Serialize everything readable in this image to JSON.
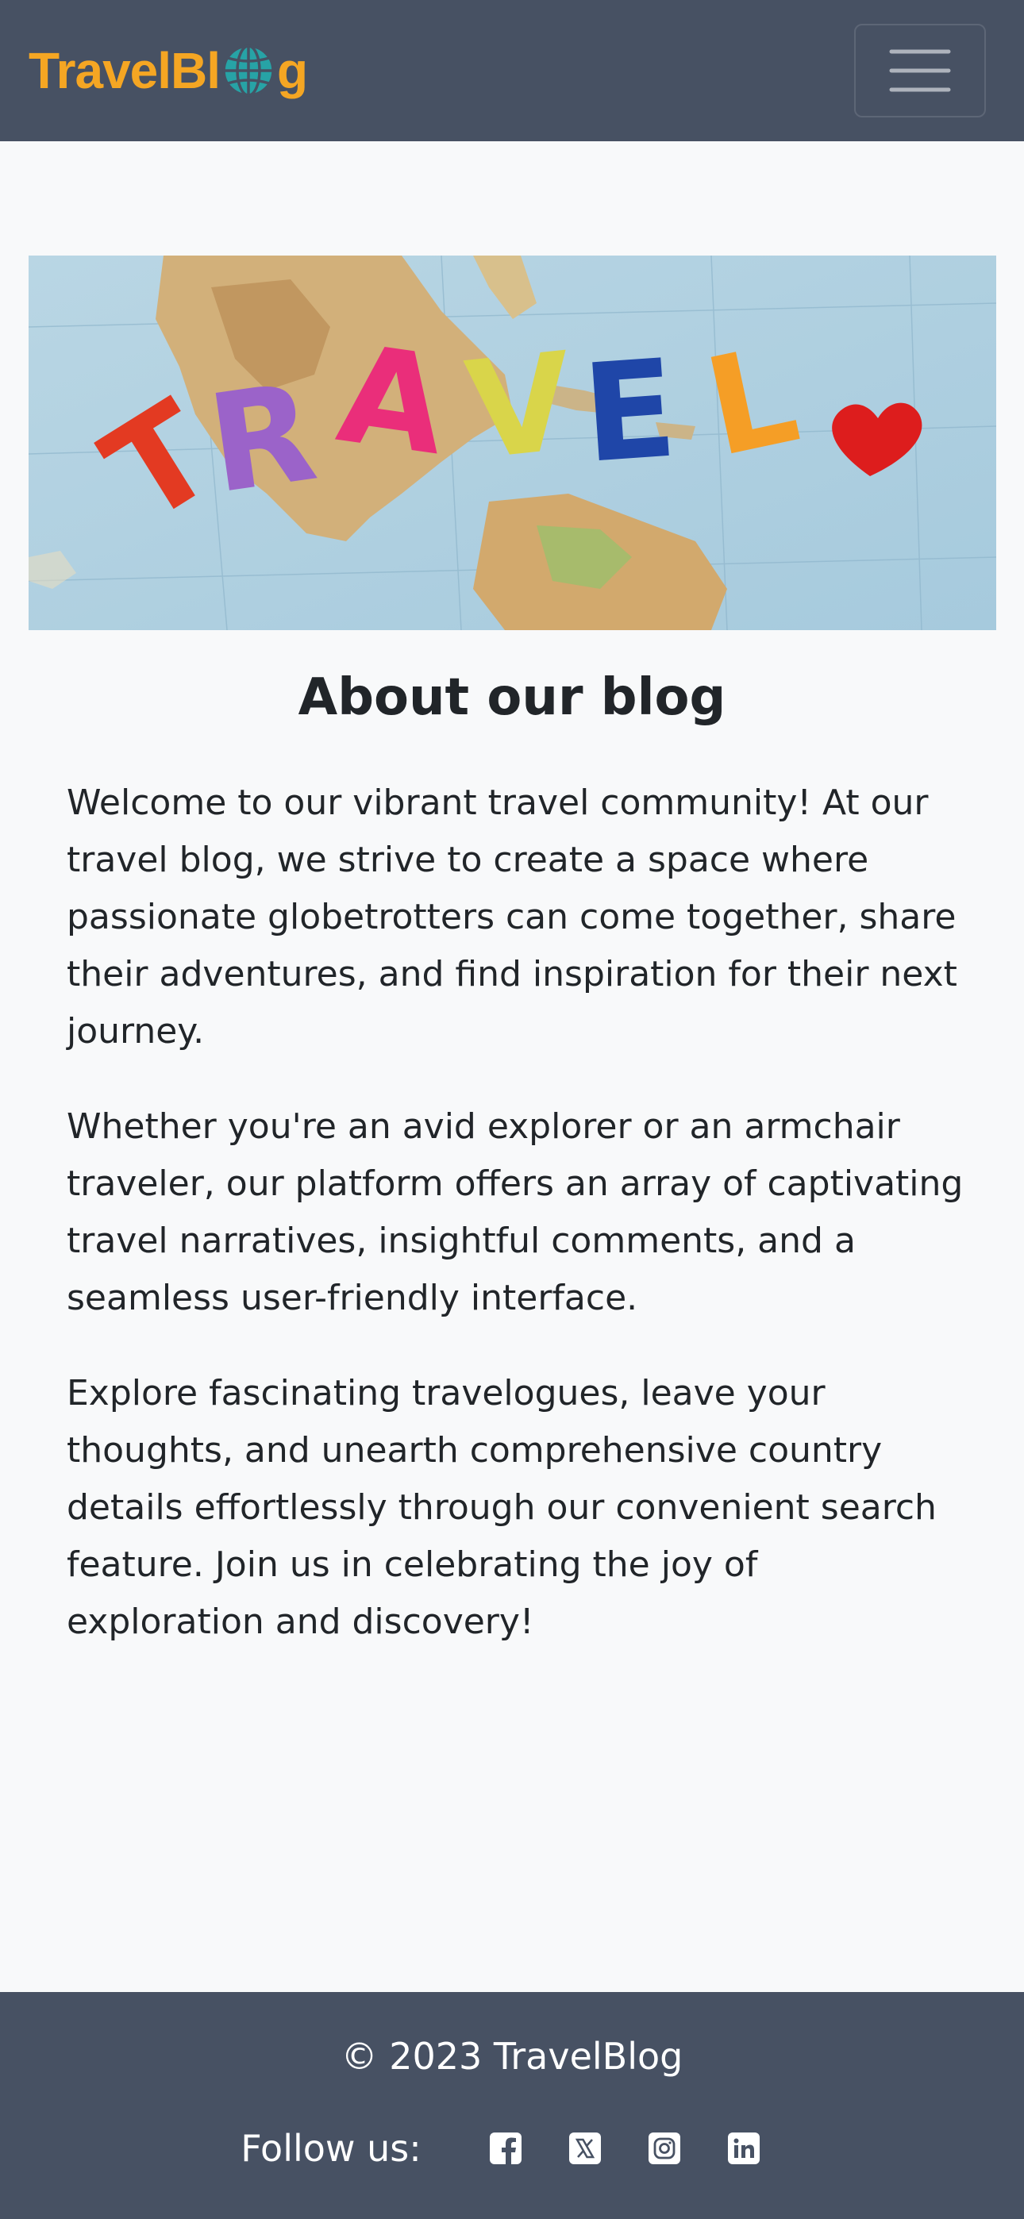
{
  "navbar": {
    "brand_prefix": "TravelBl",
    "brand_suffix": "g",
    "brand_color": "#f5a623",
    "globe_icon": "globe-icon",
    "menu_icon": "hamburger-menu-icon",
    "background": "#475163"
  },
  "hero": {
    "image_text": "TRAVEL",
    "alt": "Colorful letters spelling TRAVEL on a world map"
  },
  "main": {
    "title": "About our blog",
    "paragraphs": [
      "Welcome to our vibrant travel community! At our travel blog, we strive to create a space where passionate globetrotters can come together, share their adventures, and find inspiration for their next journey.",
      "Whether you're an avid explorer or an armchair traveler, our platform offers an array of captivating travel narratives, insightful comments, and a seamless user-friendly interface.",
      "Explore fascinating travelogues, leave your thoughts, and unearth comprehensive country details effortlessly through our convenient search feature. Join us in celebrating the joy of exploration and discovery!"
    ]
  },
  "footer": {
    "copyright": "© 2023 TravelBlog",
    "follow_label": "Follow us:",
    "social": [
      "facebook-icon",
      "x-twitter-icon",
      "instagram-icon",
      "linkedin-icon"
    ]
  }
}
